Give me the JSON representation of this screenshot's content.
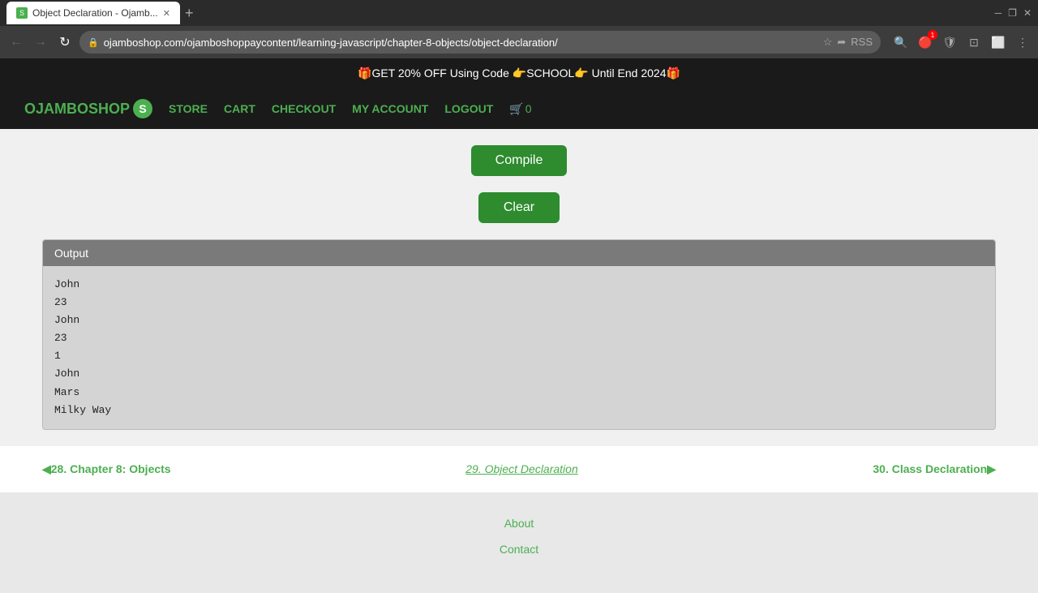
{
  "browser": {
    "tab_title": "Object Declaration - Ojamb...",
    "tab_favicon": "S",
    "url": "ojamboshop.com/ojamboshoppaycontent/learning-javascript/chapter-8-objects/object-declaration/",
    "new_tab_label": "+",
    "back_disabled": false,
    "forward_disabled": true
  },
  "promo": {
    "text": "🎁GET 20% OFF Using Code 👉SCHOOL👉 Until End 2024🎁"
  },
  "nav": {
    "logo": "OJAMBOSHOP",
    "logo_s": "S",
    "store": "STORE",
    "cart": "CART",
    "checkout": "CHECKOUT",
    "my_account": "MY ACCOUNT",
    "logout": "LOGOUT",
    "cart_count": "0"
  },
  "buttons": {
    "compile": "Compile",
    "clear": "Clear"
  },
  "output": {
    "header": "Output",
    "lines": [
      "John",
      "23",
      "John",
      "23",
      "1",
      "John",
      "Mars",
      "Milky Way"
    ]
  },
  "page_navigation": {
    "prev_label": "◀28. Chapter 8: Objects",
    "current_label": "29. Object Declaration",
    "next_label": "30. Class Declaration▶"
  },
  "footer": {
    "about": "About",
    "contact": "Contact"
  }
}
